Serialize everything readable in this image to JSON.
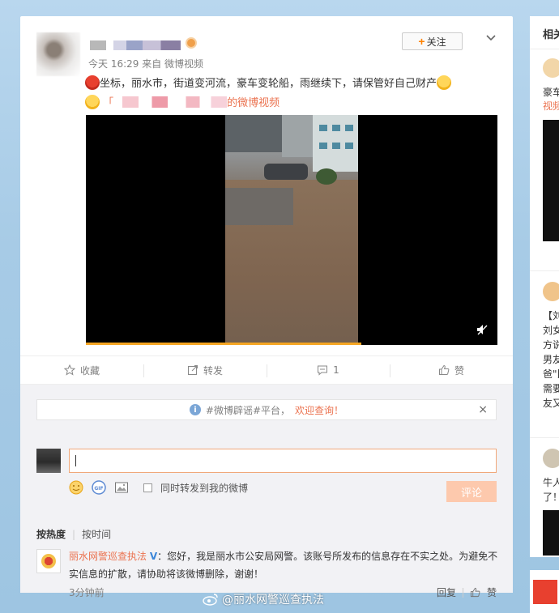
{
  "post": {
    "meta": "今天 16:29 来自 微博视频",
    "follow_label": "关注",
    "text_line1": "坐标，丽水市，街道变河流，豪车变轮船，雨继续下，请保管好自己财产",
    "source_bracket": "「",
    "source_suffix": "的微博视频"
  },
  "actions": {
    "favorite": "收藏",
    "repost": "转发",
    "comment_count": "1",
    "like": "赞"
  },
  "notice": {
    "hashtag": "#微博辟谣#平台，",
    "welcome": "欢迎查询！",
    "close": "×"
  },
  "composer": {
    "placeholder": "",
    "repost_toggle_label": "同时转发到我的微博",
    "submit_label": "评论"
  },
  "sort": {
    "by_heat": "按热度",
    "by_time": "按时间"
  },
  "comment": {
    "user": "丽水网警巡查执法",
    "verified": "V",
    "text": "：您好，我是丽水市公安局网警。该账号所发布的信息存在不实之处。为避免不实信息的扩散，请协助将该微博删除，谢谢！",
    "time": "3分钟前",
    "reply": "回复",
    "like": "赞"
  },
  "sidebar": {
    "title": "相关",
    "t1": "豪车",
    "t2": "视频",
    "t3": "【刘",
    "t4": "刘女",
    "t5": "方说",
    "t6": "男友",
    "t7": "爸\"比",
    "t8": "需要",
    "t9": "友又",
    "t10": "牛人",
    "t11": "了！"
  },
  "watermark": "@丽水网警巡查执法",
  "icons": {
    "chevron": "chevron-down-icon",
    "favorite": "star-icon",
    "repost": "repost-icon",
    "comment": "comment-icon",
    "like": "thumb-up-icon",
    "mute": "volume-mute-icon",
    "info": "info-icon",
    "emoji": "smiley-icon",
    "gif": "gif-icon",
    "image": "image-icon",
    "weibo": "weibo-logo-icon"
  },
  "colors": {
    "accent": "#eb7350",
    "follow_plus": "#ff8200",
    "progress": "#f5a623",
    "submit_disabled": "#fdc9ad"
  },
  "video": {
    "progress_fraction": 0.67
  }
}
